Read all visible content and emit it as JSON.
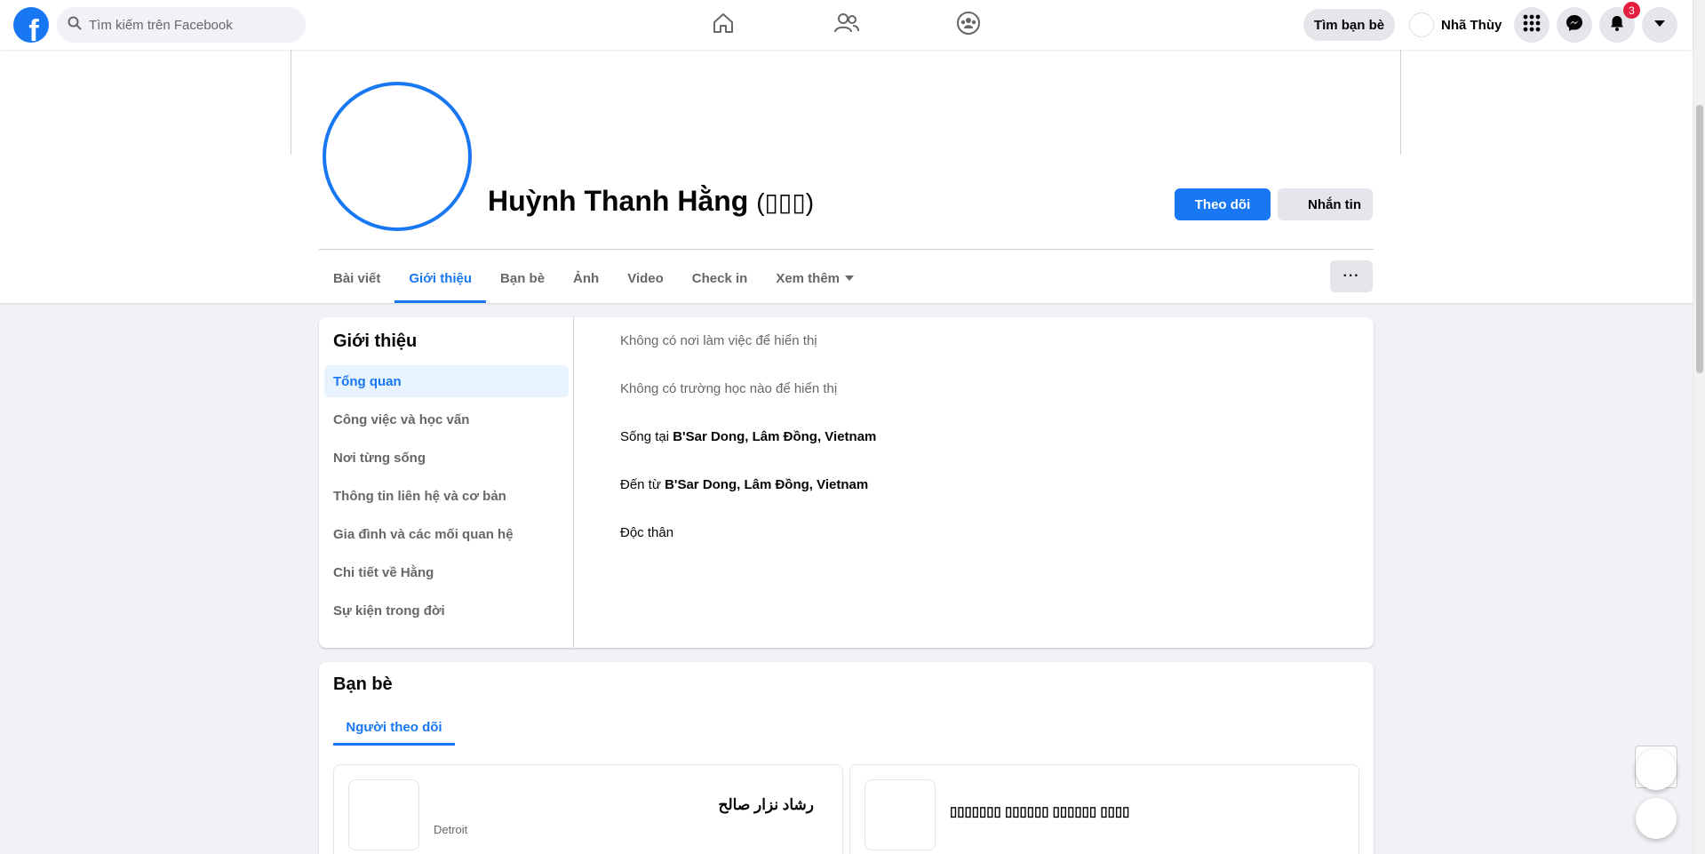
{
  "topbar": {
    "search_placeholder": "Tìm kiếm trên Facebook",
    "logo_letter": "f",
    "find_friends": "Tìm bạn bè",
    "user_name": "Nhã Thùy",
    "notifications_count": "3"
  },
  "profile": {
    "name": "Huỳnh Thanh Hằng",
    "alt_name": "(▯▯▯)",
    "follow_label": "Theo dõi",
    "message_label": "Nhắn tin"
  },
  "tabs": [
    {
      "label": "Bài viết"
    },
    {
      "label": "Giới thiệu"
    },
    {
      "label": "Bạn bè"
    },
    {
      "label": "Ảnh"
    },
    {
      "label": "Video"
    },
    {
      "label": "Check in"
    },
    {
      "label": "Xem thêm"
    }
  ],
  "more_button": "···",
  "about": {
    "title": "Giới thiệu",
    "menu": [
      "Tổng quan",
      "Công việc và học vấn",
      "Nơi từng sống",
      "Thông tin liên hệ và cơ bản",
      "Gia đình và các mối quan hệ",
      "Chi tiết về Hằng",
      "Sự kiện trong đời"
    ],
    "no_work": "Không có nơi làm việc để hiển thị",
    "no_school": "Không có trường học nào để hiển thị",
    "lives_prefix": "Sống tại ",
    "lives_place": "B'Sar Dong, Lâm Đồng, Vietnam",
    "from_prefix": "Đến từ ",
    "from_place": "B'Sar Dong, Lâm Đồng, Vietnam",
    "relationship": "Độc thân"
  },
  "friends": {
    "title": "Bạn bè",
    "tab_label": "Người theo dõi",
    "list": [
      {
        "name": "رشاد نزار صالح",
        "location": "Detroit"
      },
      {
        "name": "▯▯▯▯▯▯▯ ▯▯▯▯▯▯ ▯▯▯▯▯▯ ▯▯▯▯",
        "location": ""
      }
    ]
  },
  "colors": {
    "brand": "#1877f2",
    "badge": "#e41e3f"
  }
}
